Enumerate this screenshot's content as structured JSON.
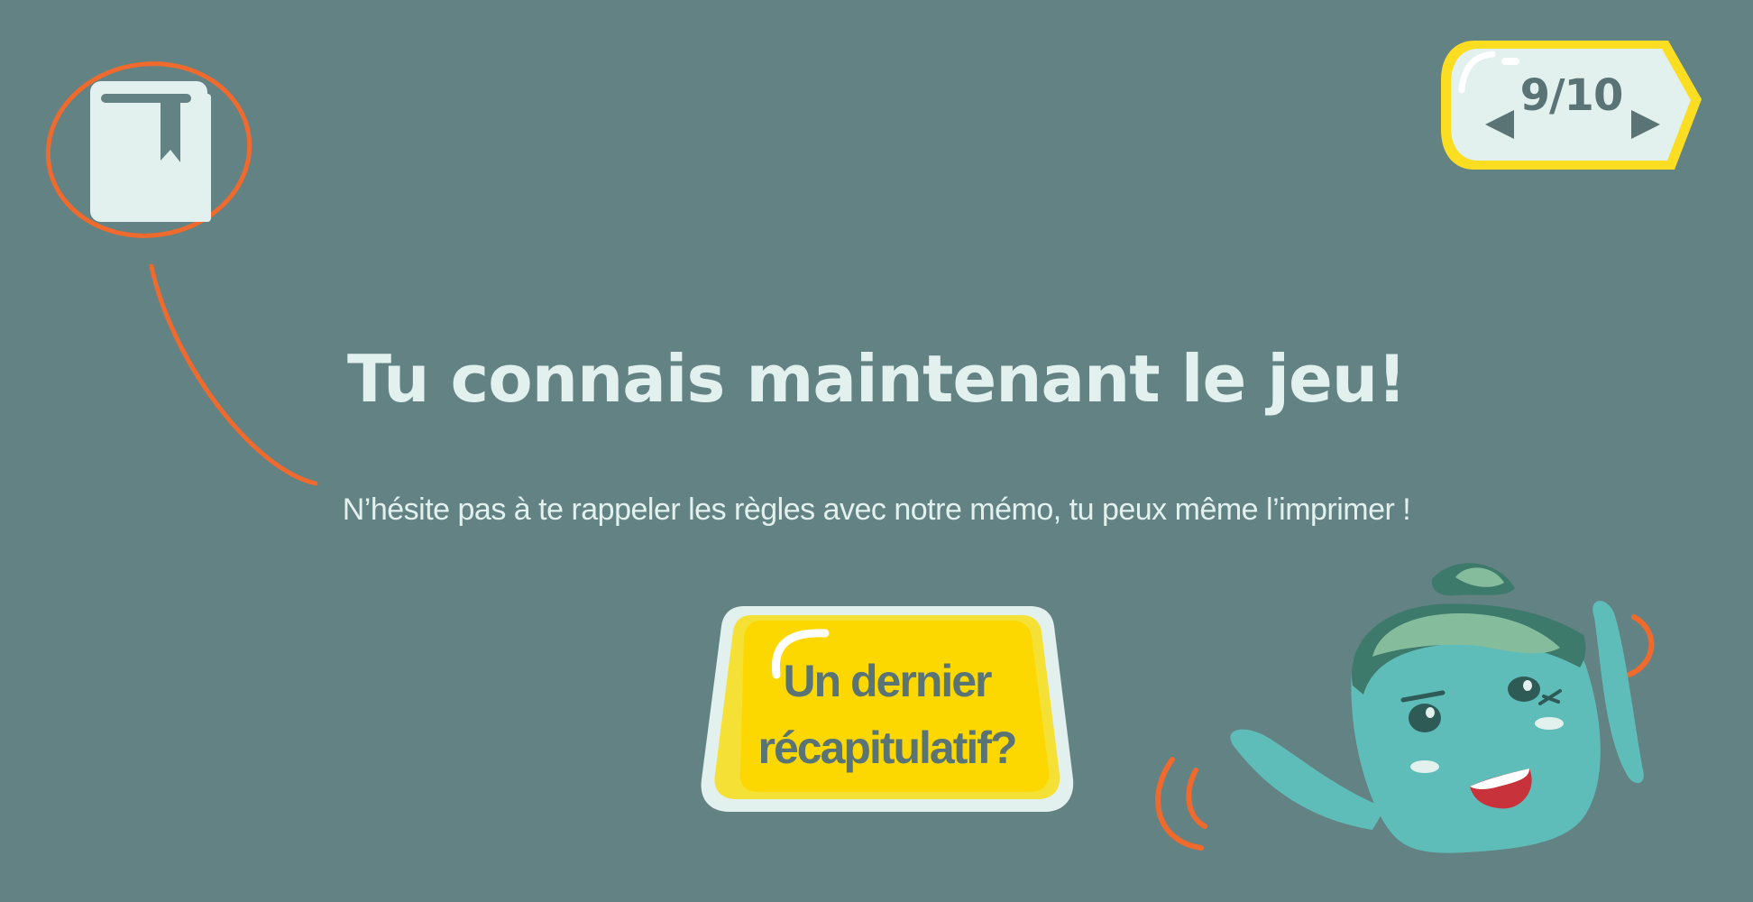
{
  "progress": {
    "current": 9,
    "total": 10,
    "label": "9/10"
  },
  "headline": "Tu connais maintenant le jeu!",
  "subline": "N’hésite pas à te rappeler les règles avec notre mémo, tu peux même l’imprimer !",
  "recap_button": {
    "line1": "Un dernier",
    "line2": "récapitulatif?"
  },
  "icons": {
    "memo": "book-bookmark-icon",
    "prev": "triangle-left-icon",
    "next": "triangle-right-icon",
    "mascot": "teapot-mascot-icon"
  },
  "colors": {
    "background": "#638284",
    "text_light": "#e2f0ee",
    "text_dark": "#5a7476",
    "accent_orange": "#ef6a2c",
    "button_yellow": "#fdd800",
    "mascot_teal": "#5fbdb9"
  }
}
